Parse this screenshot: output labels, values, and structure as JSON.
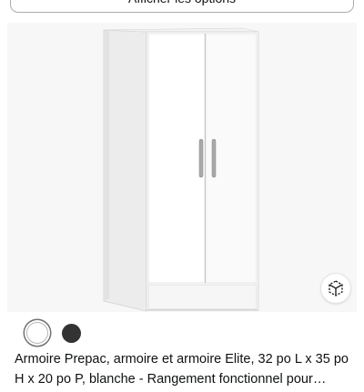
{
  "options_button": {
    "label": "Afficher les options"
  },
  "product": {
    "title": "Armoire Prepac, armoire et armoire Elite, 32 po L x 35 po H x 20 po P, blanche - Rangement fonctionnel pour chambre",
    "view_3d_icon": "3d-cube-icon",
    "colors": [
      {
        "name": "white",
        "hex": "#ffffff",
        "selected": true
      },
      {
        "name": "black",
        "hex": "#333333",
        "selected": false
      }
    ]
  }
}
